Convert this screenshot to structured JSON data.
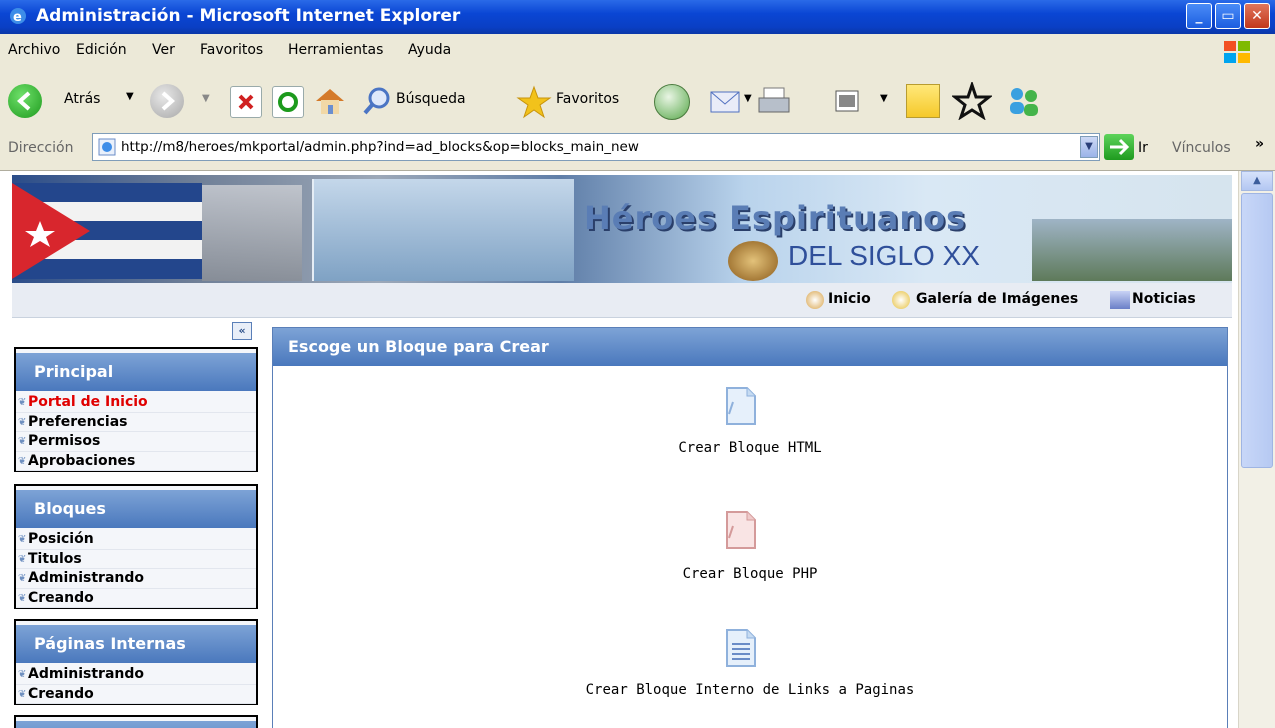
{
  "window": {
    "title": "Administración - Microsoft Internet Explorer"
  },
  "menu": [
    "Archivo",
    "Edición",
    "Ver",
    "Favoritos",
    "Herramientas",
    "Ayuda"
  ],
  "toolbar": {
    "back": "Atrás",
    "search": "Búsqueda",
    "favorites": "Favoritos"
  },
  "address": {
    "label": "Dirección",
    "url": "http://m8/heroes/mkportal/admin.php?ind=ad_blocks&op=blocks_main_new",
    "go": "Ir",
    "links": "Vínculos"
  },
  "banner": {
    "title": "Héroes Espirituanos",
    "subtitle": "DEL SIGLO XX"
  },
  "topnav": [
    "Inicio",
    "Galería de Imágenes",
    "Noticias"
  ],
  "sidebar": [
    {
      "title": "Principal",
      "items": [
        "Portal de Inicio",
        "Preferencias",
        "Permisos",
        "Aprobaciones"
      ]
    },
    {
      "title": "Bloques",
      "items": [
        "Posición",
        "Titulos",
        "Administrando",
        "Creando"
      ]
    },
    {
      "title": "Páginas Internas",
      "items": [
        "Administrando",
        "Creando"
      ]
    }
  ],
  "main": {
    "heading": "Escoge un Bloque para Crear",
    "options": [
      "Crear Bloque HTML",
      "Crear Bloque PHP",
      "Crear Bloque Interno de Links a Paginas"
    ]
  },
  "colors": {
    "titlebar": "#0a46d4",
    "panel_header": "#4a78bd",
    "active_link": "#e00000"
  }
}
